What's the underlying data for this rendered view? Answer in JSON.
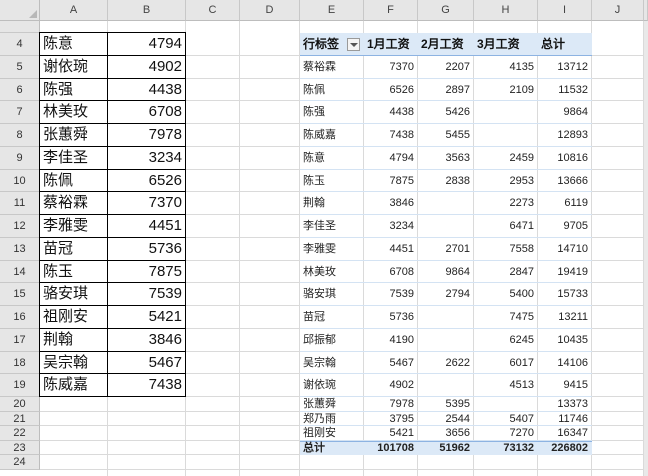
{
  "columns": [
    "A",
    "B",
    "C",
    "D",
    "E",
    "F",
    "G",
    "H",
    "I",
    "J"
  ],
  "rows": [
    4,
    5,
    6,
    7,
    8,
    9,
    10,
    11,
    12,
    13,
    14,
    15,
    16,
    17,
    18,
    19,
    20,
    21,
    22,
    23,
    24
  ],
  "list": [
    {
      "name": "陈意",
      "value": "4794"
    },
    {
      "name": "谢依琬",
      "value": "4902"
    },
    {
      "name": "陈强",
      "value": "4438"
    },
    {
      "name": "林美玫",
      "value": "6708"
    },
    {
      "name": "张蕙舜",
      "value": "7978"
    },
    {
      "name": "李佳圣",
      "value": "3234"
    },
    {
      "name": "陈佩",
      "value": "6526"
    },
    {
      "name": "蔡裕霖",
      "value": "7370"
    },
    {
      "name": "李雅雯",
      "value": "4451"
    },
    {
      "name": "苗冠",
      "value": "5736"
    },
    {
      "name": "陈玉",
      "value": "7875"
    },
    {
      "name": "骆安琪",
      "value": "7539"
    },
    {
      "name": "祖刚安",
      "value": "5421"
    },
    {
      "name": "荆翰",
      "value": "3846"
    },
    {
      "name": "吴宗翰",
      "value": "5467"
    },
    {
      "name": "陈威嘉",
      "value": "7438"
    }
  ],
  "pivot": {
    "headers": {
      "rowlabel": "行标签",
      "m1": "1月工资",
      "m2": "2月工资",
      "m3": "3月工资",
      "total": "总计"
    },
    "rows": [
      {
        "name": "蔡裕霖",
        "m1": "7370",
        "m2": "2207",
        "m3": "4135",
        "total": "13712"
      },
      {
        "name": "陈佩",
        "m1": "6526",
        "m2": "2897",
        "m3": "2109",
        "total": "11532"
      },
      {
        "name": "陈强",
        "m1": "4438",
        "m2": "5426",
        "m3": "",
        "total": "9864"
      },
      {
        "name": "陈威嘉",
        "m1": "7438",
        "m2": "5455",
        "m3": "",
        "total": "12893"
      },
      {
        "name": "陈意",
        "m1": "4794",
        "m2": "3563",
        "m3": "2459",
        "total": "10816"
      },
      {
        "name": "陈玉",
        "m1": "7875",
        "m2": "2838",
        "m3": "2953",
        "total": "13666"
      },
      {
        "name": "荆翰",
        "m1": "3846",
        "m2": "",
        "m3": "2273",
        "total": "6119"
      },
      {
        "name": "李佳圣",
        "m1": "3234",
        "m2": "",
        "m3": "6471",
        "total": "9705"
      },
      {
        "name": "李雅雯",
        "m1": "4451",
        "m2": "2701",
        "m3": "7558",
        "total": "14710"
      },
      {
        "name": "林美玫",
        "m1": "6708",
        "m2": "9864",
        "m3": "2847",
        "total": "19419"
      },
      {
        "name": "骆安琪",
        "m1": "7539",
        "m2": "2794",
        "m3": "5400",
        "total": "15733"
      },
      {
        "name": "苗冠",
        "m1": "5736",
        "m2": "",
        "m3": "7475",
        "total": "13211"
      },
      {
        "name": "邱振郁",
        "m1": "4190",
        "m2": "",
        "m3": "6245",
        "total": "10435"
      },
      {
        "name": "吴宗翰",
        "m1": "5467",
        "m2": "2622",
        "m3": "6017",
        "total": "14106"
      },
      {
        "name": "谢依琬",
        "m1": "4902",
        "m2": "",
        "m3": "4513",
        "total": "9415"
      },
      {
        "name": "张蕙舜",
        "m1": "7978",
        "m2": "5395",
        "m3": "",
        "total": "13373"
      },
      {
        "name": "郑乃雨",
        "m1": "3795",
        "m2": "2544",
        "m3": "5407",
        "total": "11746"
      },
      {
        "name": "祖刚安",
        "m1": "5421",
        "m2": "3656",
        "m3": "7270",
        "total": "16347"
      }
    ],
    "total": {
      "name": "总计",
      "m1": "101708",
      "m2": "51962",
      "m3": "73132",
      "total": "226802"
    }
  }
}
